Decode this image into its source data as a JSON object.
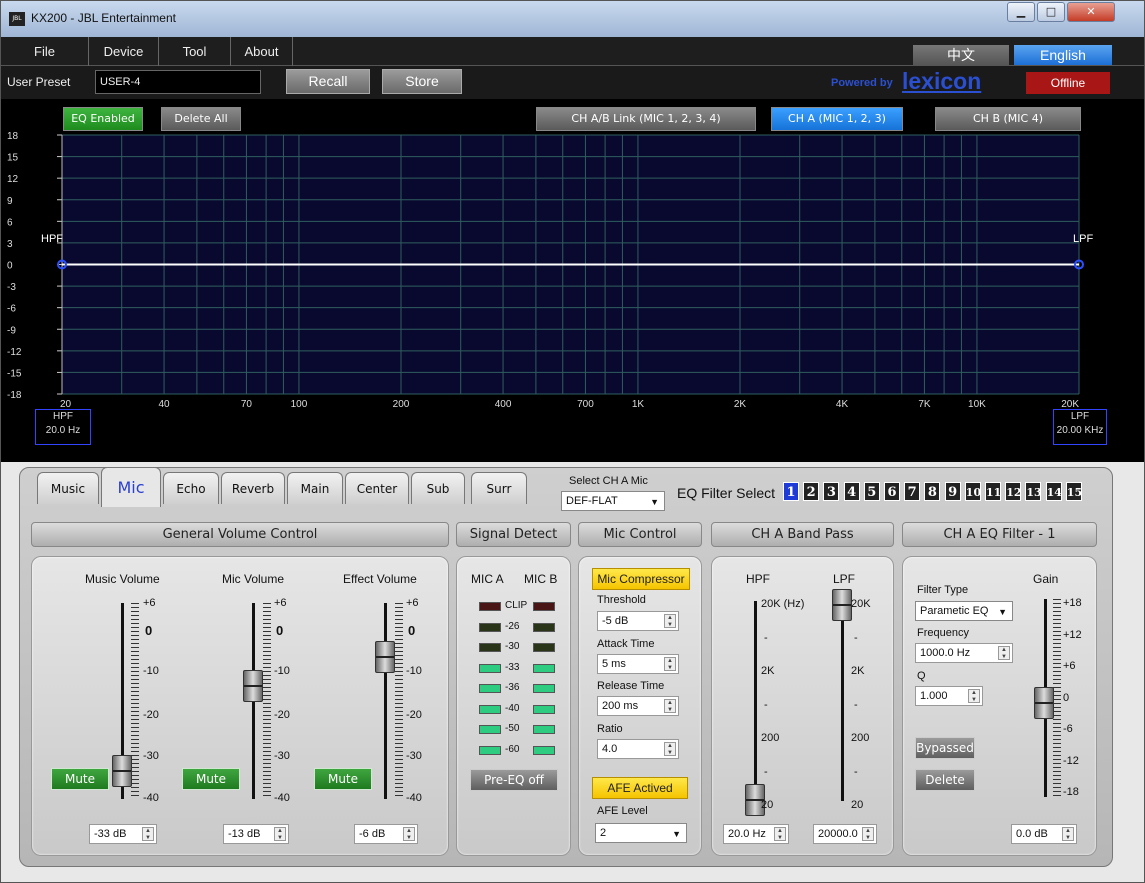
{
  "window": {
    "title": "KX200 - JBL Entertainment",
    "app_icon_text": "JBL"
  },
  "menu": [
    "File",
    "Device",
    "Tool",
    "About"
  ],
  "language": {
    "chinese": "中文",
    "english": "English"
  },
  "preset": {
    "label": "User Preset",
    "value": "USER-4",
    "recall": "Recall",
    "store": "Store"
  },
  "brand": {
    "powered_by": "Powered by",
    "name": "lexicon"
  },
  "status": "Offline",
  "eq": {
    "enabled_label": "EQ Enabled",
    "delete_all_label": "Delete All",
    "link_label": "CH A/B Link (MIC 1, 2, 3, 4)",
    "ch_a_label": "CH A (MIC 1, 2, 3)",
    "ch_b_label": "CH B (MIC 4)",
    "hpf_marker": "HPF",
    "lpf_marker": "LPF",
    "hpf_box_label": "HPF",
    "hpf_box_value": "20.0 Hz",
    "lpf_box_label": "LPF",
    "lpf_box_value": "20.00 KHz"
  },
  "chart_data": {
    "type": "line",
    "y_ticks": [
      "18",
      "15",
      "12",
      "9",
      "6",
      "3",
      "0",
      "-3",
      "-6",
      "-9",
      "-12",
      "-15",
      "-18"
    ],
    "x_ticks": [
      "20",
      "40",
      "70",
      "100",
      "200",
      "400",
      "700",
      "1K",
      "2K",
      "4K",
      "7K",
      "10K",
      "20K"
    ],
    "x_tick_values": [
      20,
      40,
      70,
      100,
      200,
      400,
      700,
      1000,
      2000,
      4000,
      7000,
      10000,
      20000
    ],
    "xscale": "log",
    "xlim": [
      20,
      20000
    ],
    "ylim": [
      -18,
      18
    ],
    "grid": true,
    "series": [
      {
        "x": [
          20,
          20000
        ],
        "y": [
          0,
          0
        ]
      }
    ]
  },
  "tabs": [
    "Music",
    "Mic",
    "Echo",
    "Reverb",
    "Main",
    "Center",
    "Sub",
    "Surr"
  ],
  "active_tab": "Mic",
  "mic_select": {
    "label": "Select CH A Mic",
    "value": "DEF-FLAT"
  },
  "eq_filter_select": {
    "label": "EQ Filter Select",
    "numbers": [
      "1",
      "2",
      "3",
      "4",
      "5",
      "6",
      "7",
      "8",
      "9",
      "10",
      "11",
      "12",
      "13",
      "14",
      "15"
    ],
    "selected": "1"
  },
  "sections": {
    "general": "General Volume Control",
    "signal": "Signal Detect",
    "mic_control": "Mic Control",
    "band_pass": "CH A Band Pass",
    "eq_filter": "CH A EQ Filter - 1"
  },
  "volume": {
    "scale": [
      "+6",
      "0",
      "-10",
      "-20",
      "-30",
      "-40"
    ],
    "mute_label": "Mute",
    "music": {
      "label": "Music Volume",
      "value": "-33 dB"
    },
    "mic": {
      "label": "Mic Volume",
      "value": "-13 dB"
    },
    "effect": {
      "label": "Effect Volume",
      "value": "-6 dB"
    }
  },
  "signal": {
    "mic_a": "MIC A",
    "mic_b": "MIC B",
    "levels": [
      "CLIP",
      "-26",
      "-30",
      "-33",
      "-36",
      "-40",
      "-50",
      "-60"
    ],
    "pre_eq": "Pre-EQ off"
  },
  "mic_control": {
    "compressor": "Mic Compressor",
    "threshold_label": "Threshold",
    "threshold": "-5 dB",
    "attack_label": "Attack Time",
    "attack": "5 ms",
    "release_label": "Release Time",
    "release": "200 ms",
    "ratio_label": "Ratio",
    "ratio": "4.0",
    "afe": "AFE Actived",
    "afe_level_label": "AFE Level",
    "afe_level": "2"
  },
  "band_pass": {
    "hpf_label": "HPF",
    "lpf_label": "LPF",
    "hpf_scale": [
      "20K (Hz)",
      "-",
      "2K",
      "-",
      "200",
      "-",
      "20"
    ],
    "lpf_scale": [
      "20K",
      "-",
      "2K",
      "-",
      "200",
      "-",
      "20"
    ],
    "hpf_value": "20.0 Hz",
    "lpf_value": "20000.0"
  },
  "eq_filter": {
    "type_label": "Filter Type",
    "type": "Parametic EQ",
    "freq_label": "Frequency",
    "freq": "1000.0 Hz",
    "q_label": "Q",
    "q": "1.000",
    "bypassed": "Bypassed",
    "delete": "Delete",
    "gain_label": "Gain",
    "gain_scale": [
      "+18",
      "+12",
      "+6",
      "0",
      "-6",
      "-12",
      "-18"
    ],
    "gain_value": "0.0 dB"
  }
}
